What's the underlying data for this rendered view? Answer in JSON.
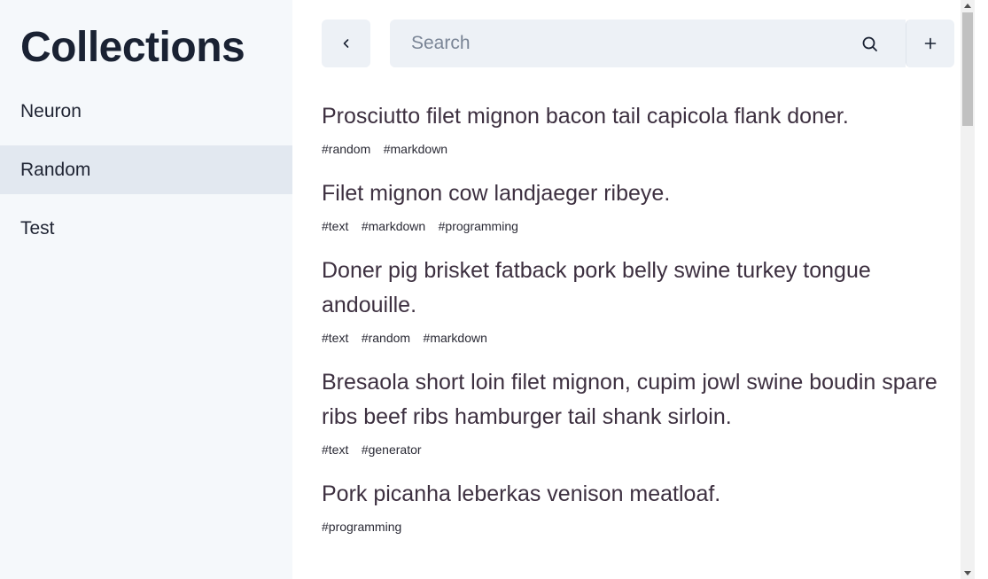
{
  "sidebar": {
    "title": "Collections",
    "items": [
      {
        "label": "Neuron"
      },
      {
        "label": "Random"
      },
      {
        "label": "Test"
      }
    ]
  },
  "toolbar": {
    "back_icon": "chevron-left-icon",
    "search_placeholder": "Search",
    "search_icon": "search-icon",
    "add_icon": "plus-icon"
  },
  "notes": [
    {
      "title": "Prosciutto filet mignon bacon tail capicola flank doner.",
      "tags": [
        "#random",
        "#markdown"
      ]
    },
    {
      "title": "Filet mignon cow landjaeger ribeye.",
      "tags": [
        "#text",
        "#markdown",
        "#programming"
      ]
    },
    {
      "title": "Doner pig brisket fatback pork belly swine turkey tongue andouille.",
      "tags": [
        "#text",
        "#random",
        "#markdown"
      ]
    },
    {
      "title": "Bresaola short loin filet mignon, cupim jowl swine boudin spare ribs beef ribs hamburger tail shank sirloin.",
      "tags": [
        "#text",
        "#generator"
      ]
    },
    {
      "title": "Pork picanha leberkas venison meatloaf.",
      "tags": [
        "#programming"
      ]
    }
  ]
}
